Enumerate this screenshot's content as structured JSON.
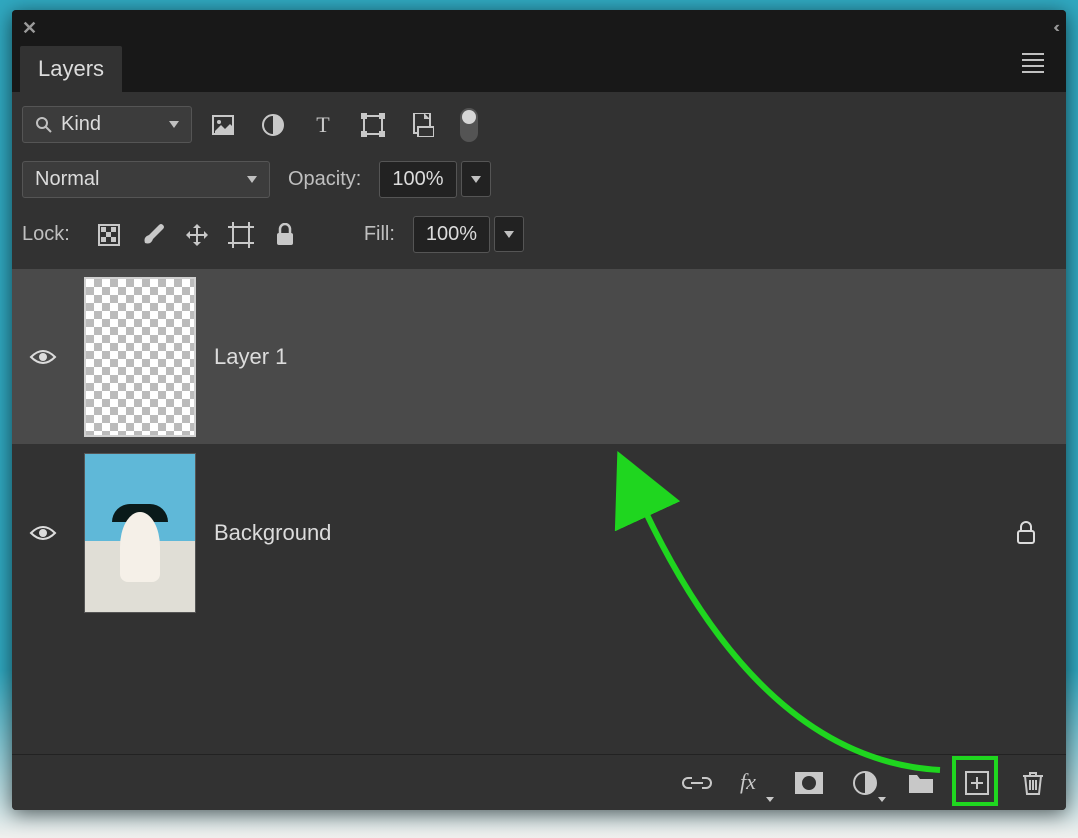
{
  "panel": {
    "title": "Layers",
    "filter_mode": "Kind",
    "blend_mode": "Normal",
    "opacity_label": "Opacity:",
    "opacity_value": "100%",
    "lock_label": "Lock:",
    "fill_label": "Fill:",
    "fill_value": "100%"
  },
  "layers": [
    {
      "name": "Layer 1",
      "visible": true,
      "selected": true,
      "locked": false,
      "thumb": "transparent"
    },
    {
      "name": "Background",
      "visible": true,
      "selected": false,
      "locked": true,
      "thumb": "photo"
    }
  ],
  "annotation": {
    "highlight_layer_index": 0,
    "highlight_button": "new-layer"
  }
}
